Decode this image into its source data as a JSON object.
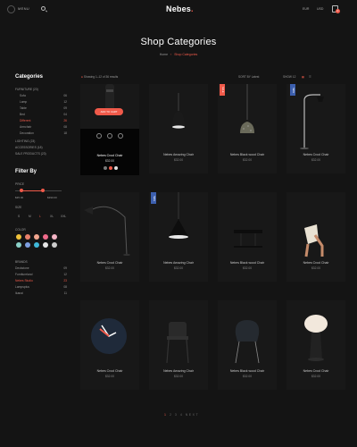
{
  "header": {
    "menu_label": "MENU",
    "logo": "Nebes",
    "links": [
      "EUR",
      "USD"
    ],
    "cart_count": "0"
  },
  "page": {
    "title": "Shop Categories",
    "breadcrumb": [
      "Home",
      "Shop Categories"
    ]
  },
  "sidebar": {
    "categories_title": "Categories",
    "group1": "FURNITURE (23)",
    "cats": [
      {
        "label": "Sofa",
        "count": "06"
      },
      {
        "label": "Lamp",
        "count": "12"
      },
      {
        "label": "Table",
        "count": "09"
      },
      {
        "label": "Bed",
        "count": "04"
      },
      {
        "label": "Different",
        "count": "26"
      },
      {
        "label": "Armchair",
        "count": "08"
      },
      {
        "label": "Decoration",
        "count": "18"
      }
    ],
    "group2": "LIGHTING (23)",
    "group3": "ACCESSORIES (18)",
    "group4": "SALE PRODUCTS (23)",
    "filter_title": "Filter By",
    "price_title": "PRICE",
    "price_min": "$35.00",
    "price_max": "$390.00",
    "size_title": "SIZE",
    "sizes": [
      "S",
      "M",
      "L",
      "XL",
      "XXL"
    ],
    "active_size": "L",
    "color_title": "COLOR",
    "colors": [
      "#f0c23a",
      "#e87f6a",
      "#f2a68f",
      "#f06b8b",
      "#f4b4c5",
      "#8bd0c8",
      "#7d9fe0",
      "#3fb8d8",
      "#e6e6e6",
      "#cccccc"
    ],
    "brands_title": "BRANDS",
    "brands": [
      {
        "label": "Deckstone",
        "count": "09"
      },
      {
        "label": "Furnitureland",
        "count": "12"
      },
      {
        "label": "Nebes Studio",
        "count": "23"
      },
      {
        "label": "Lampsplus",
        "count": "08"
      },
      {
        "label": "Ikanai",
        "count": "11"
      }
    ]
  },
  "toolbar": {
    "showing": "Showing 1–12 of 36 results",
    "sort_label": "SORT BY",
    "sort_value": "Latest",
    "show_label": "SHOW",
    "show_value": "12"
  },
  "products": [
    {
      "name": "Nebes Crool Chair",
      "price": "$32.00",
      "featured": true,
      "action": "ADD TO CART"
    },
    {
      "name": "Nebes Amazing Chair",
      "price": "$32.00"
    },
    {
      "name": "Nebes Black wood Chair",
      "price": "$32.00",
      "badge": "SALE",
      "badge_color": "#f05a4a"
    },
    {
      "name": "Nebes Crool Chair",
      "price": "$32.00",
      "badge": "NEW",
      "badge_color": "#3c5fae"
    },
    {
      "name": "Nebes Crool Chair",
      "price": "$32.00"
    },
    {
      "name": "Nebes Amazing Chair",
      "price": "$32.00",
      "badge": "NEW",
      "badge_color": "#3c5fae"
    },
    {
      "name": "Nebes Black wood Chair",
      "price": "$32.00"
    },
    {
      "name": "Nebes Crool Chair",
      "price": "$32.00"
    },
    {
      "name": "Nebes Crool Chair",
      "price": "$32.00"
    },
    {
      "name": "Nebes Amazing Chair",
      "price": "$32.00"
    },
    {
      "name": "Nebes Black wood Chair",
      "price": "$32.00"
    },
    {
      "name": "Nebes Crool Chair",
      "price": "$32.00"
    }
  ],
  "pager": [
    "1",
    "2",
    "3",
    "4",
    "NEXT"
  ],
  "accent": "#f05a4a"
}
